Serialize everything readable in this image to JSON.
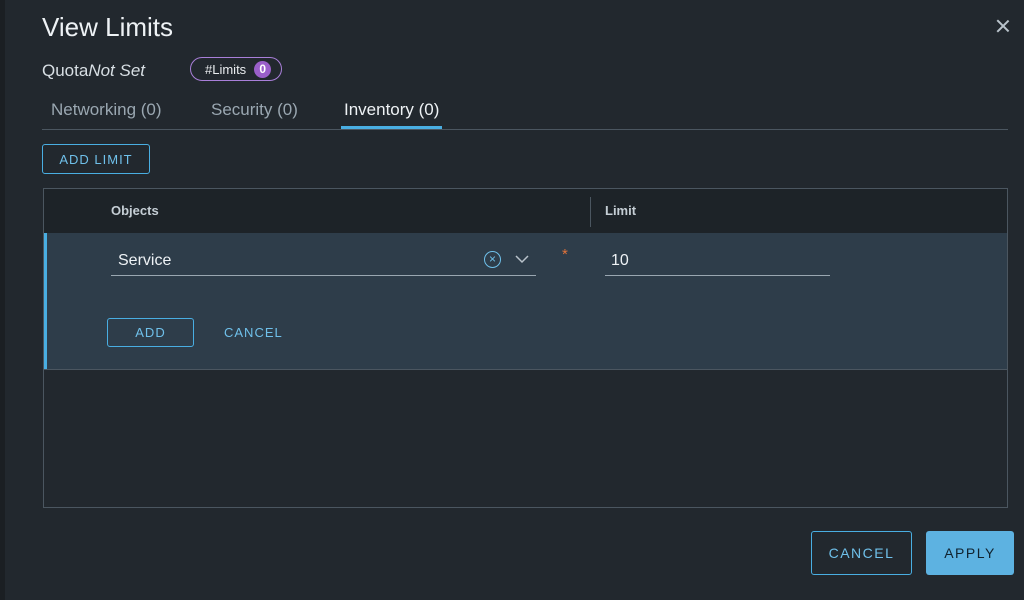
{
  "dialog": {
    "title": "View Limits",
    "quota_label": "Quota",
    "quota_value": "Not Set",
    "limits_badge": {
      "label": "#Limits",
      "count": "0"
    }
  },
  "tabs": [
    {
      "label": "Networking (0)",
      "active": false
    },
    {
      "label": "Security (0)",
      "active": false
    },
    {
      "label": "Inventory (0)",
      "active": true
    }
  ],
  "toolbar": {
    "add_limit_label": "ADD LIMIT"
  },
  "grid": {
    "columns": [
      "Objects",
      "Limit"
    ],
    "edit_row": {
      "object_value": "Service",
      "limit_value": "10",
      "required_mark": "*",
      "add_label": "ADD",
      "cancel_label": "CANCEL"
    }
  },
  "footer": {
    "cancel_label": "CANCEL",
    "apply_label": "APPLY"
  },
  "icons": {
    "close": "close-icon",
    "clear": "clear-icon",
    "dropdown": "chevron-down-icon"
  },
  "colors": {
    "accent": "#49aee2",
    "badge": "#9a5fc9",
    "required": "#e2733a",
    "background": "#22282e"
  }
}
